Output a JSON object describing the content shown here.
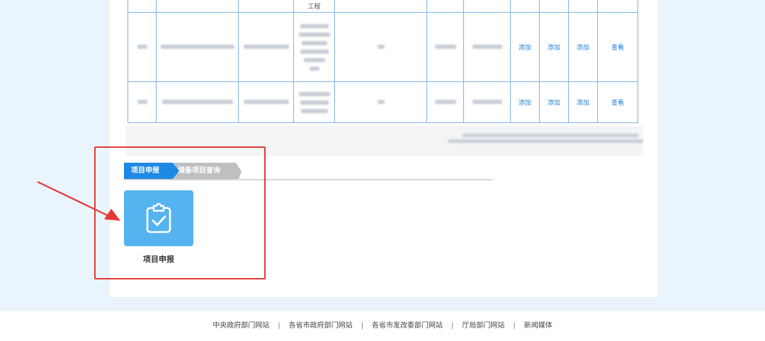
{
  "table": {
    "top_row_partial_text": "工程",
    "rows": [
      {
        "actions": [
          "添加",
          "添加",
          "添加"
        ],
        "view": "查看"
      },
      {
        "actions": [
          "添加",
          "添加",
          "添加"
        ],
        "view": "查看"
      }
    ]
  },
  "tabs": [
    {
      "label": "项目申报",
      "active": true
    },
    {
      "label": "储备项目查询",
      "active": false
    }
  ],
  "tile": {
    "label": "项目申报",
    "icon": "clipboard-check-icon",
    "color": "#55b3ef"
  },
  "colors": {
    "accent": "#1e88e5",
    "annotation": "#e53935",
    "link": "#1f7fd6"
  },
  "footer": {
    "links": [
      "中央政府部门网站",
      "各省市政府部门网站",
      "各省市发改委部门网站",
      "厅局部门网站",
      "新闻媒体"
    ],
    "separator": "|"
  }
}
